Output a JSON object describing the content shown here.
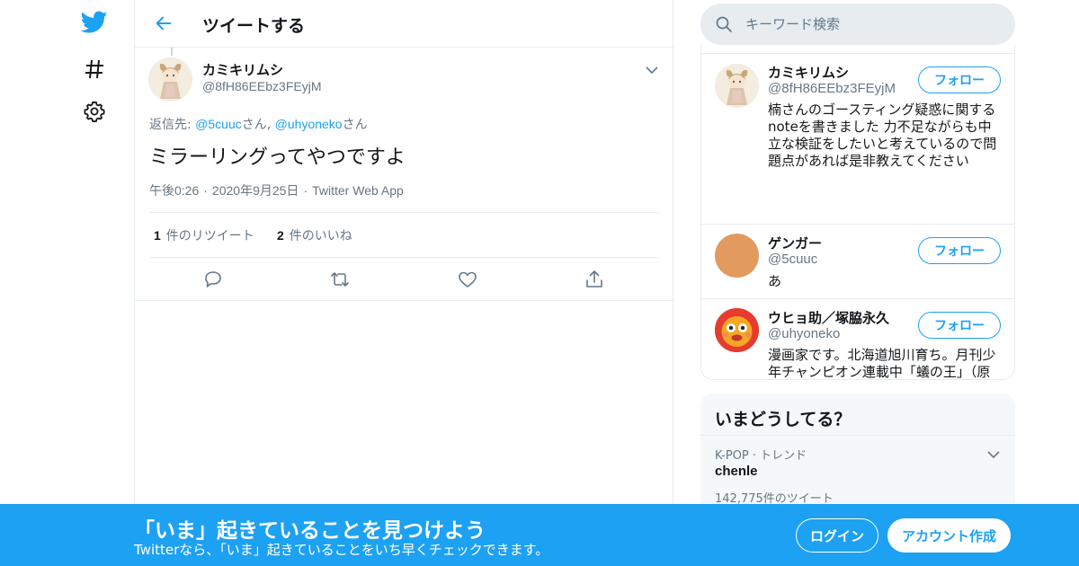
{
  "colors": {
    "brand": "#1da1f2",
    "text": "#14171a",
    "muted": "#657786",
    "border": "#e6ecf0"
  },
  "header": {
    "title": "ツイートする"
  },
  "tweet": {
    "author_name": "カミキリムシ",
    "author_handle": "@8fH86EEbz3FEyjM",
    "reply_prefix": "返信先: ",
    "reply_user1": "@5cuuc",
    "reply_san1": "さん",
    "reply_sep": ", ",
    "reply_user2": "@uhyoneko",
    "reply_san2": "さん",
    "text": "ミラーリングってやつですよ",
    "time": "午後0:26",
    "date": "2020年9月25日",
    "source": "Twitter Web App",
    "dot": "·",
    "retweet_count": "1",
    "retweet_label": "件のリツイート",
    "like_count": "2",
    "like_label": "件のいいね"
  },
  "search": {
    "placeholder": "キーワード検索"
  },
  "who_to_follow": {
    "follow_label": "フォロー",
    "users": [
      {
        "name": "カミキリムシ",
        "handle": "@8fH86EEbz3FEyjM",
        "bio": "楠さんのゴースティング疑惑に関するnoteを書きました 力不足ながらも中立な検証をしたいと考えているので問題点があれば是非教えてください"
      },
      {
        "name": "ゲンガー",
        "handle": "@5cuuc",
        "bio": "あ"
      },
      {
        "name": "ウヒョ助／塚脇永久",
        "handle": "@uhyoneko",
        "bio": "漫画家です。北海道旭川育ち。月刊少年チャンピオン連載中「蟻の王」（原作担当）近代麻雀連載中「キリンジゲート」"
      }
    ]
  },
  "trends": {
    "title": "いまどうしてる？",
    "items": [
      {
        "meta": "K-POP · トレンド",
        "name": "chenle",
        "count": "142,775件のツイート"
      }
    ]
  },
  "bottom_bar": {
    "title": "「いま」起きていることを見つけよう",
    "subtitle": "Twitterなら、「いま」起きていることをいち早くチェックできます。",
    "login_label": "ログイン",
    "signup_label": "アカウント作成"
  }
}
